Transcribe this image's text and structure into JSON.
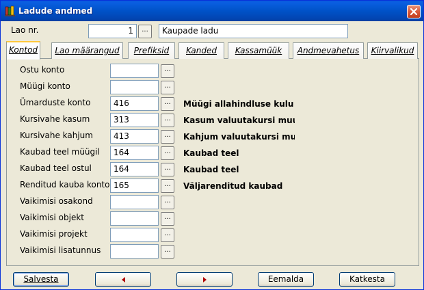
{
  "window": {
    "title": "Ladude andmed"
  },
  "header": {
    "lao_nr_label": "Lao nr.",
    "lao_nr_value": "1",
    "lao_name": "Kaupade ladu"
  },
  "tabs": [
    {
      "label": "Kontod",
      "active": true
    },
    {
      "label": "Lao määrangud"
    },
    {
      "label": "Prefiksid"
    },
    {
      "label": "Kanded"
    },
    {
      "label": "Kassamüük"
    },
    {
      "label": "Andmevahetus"
    },
    {
      "label": "Kiirvalikud"
    }
  ],
  "rows": [
    {
      "label": "Ostu konto",
      "value": "",
      "desc": ""
    },
    {
      "label": "Müügi konto",
      "value": "",
      "desc": ""
    },
    {
      "label": "Ümarduste konto",
      "value": "416",
      "desc": "Müügi allahindluse kulu"
    },
    {
      "label": "Kursivahe kasum",
      "value": "313",
      "desc": "Kasum valuutakursi muutuse"
    },
    {
      "label": "Kursivahe kahjum",
      "value": "413",
      "desc": "Kahjum valuutakursi muutuse"
    },
    {
      "label": "Kaubad teel müügil",
      "value": "164",
      "desc": "Kaubad teel"
    },
    {
      "label": "Kaubad teel ostul",
      "value": "164",
      "desc": "Kaubad teel"
    },
    {
      "label": "Renditud kauba konto",
      "value": "165",
      "desc": "Väljarenditud kaubad"
    },
    {
      "label": "Vaikimisi osakond",
      "value": "",
      "desc": ""
    },
    {
      "label": "Vaikimisi objekt",
      "value": "",
      "desc": ""
    },
    {
      "label": "Vaikimisi projekt",
      "value": "",
      "desc": ""
    },
    {
      "label": "Vaikimisi lisatunnus",
      "value": "",
      "desc": ""
    }
  ],
  "ellipsis": "...",
  "buttons": {
    "save": "Salvesta",
    "remove": "Eemalda",
    "cancel": "Katkesta"
  },
  "icons": {
    "app": "books-icon",
    "close": "close-icon",
    "prev": "arrow-left-icon",
    "next": "arrow-right-icon"
  }
}
